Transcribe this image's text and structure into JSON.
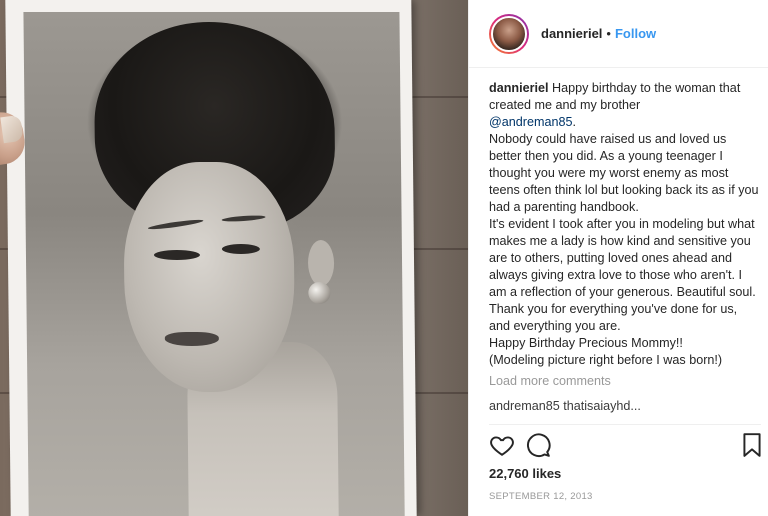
{
  "post": {
    "username": "dannieriel",
    "separator": "•",
    "follow_label": "Follow",
    "caption": {
      "user": "dannieriel",
      "line1": " Happy birthday to the woman that created me and my brother",
      "mention": "@andreman85",
      "mention_tail": ".",
      "lines": [
        "Nobody could have raised us and loved us better then you did. As a young teenager I thought you were my worst enemy as most teens often think lol but looking back its as if you had a parenting handbook.",
        "It's evident I took after you in modeling but what makes me a lady is how kind and sensitive you are to others, putting loved ones ahead and always giving extra love to those who aren't. I am a reflection of your generous. Beautiful soul.",
        "Thank you for everything you've done for us, and everything you are.",
        "Happy Birthday Precious Mommy!!",
        "(Modeling picture right before I was born!)"
      ]
    },
    "load_more_label": "Load more comments",
    "partial_comment": "andreman85 thatisaiayhd...",
    "likes": "22,760 likes",
    "date": "SEPTEMBER 12, 2013"
  },
  "icons": {
    "like": "heart-icon",
    "comment": "comment-bubble-icon",
    "save": "bookmark-icon"
  }
}
